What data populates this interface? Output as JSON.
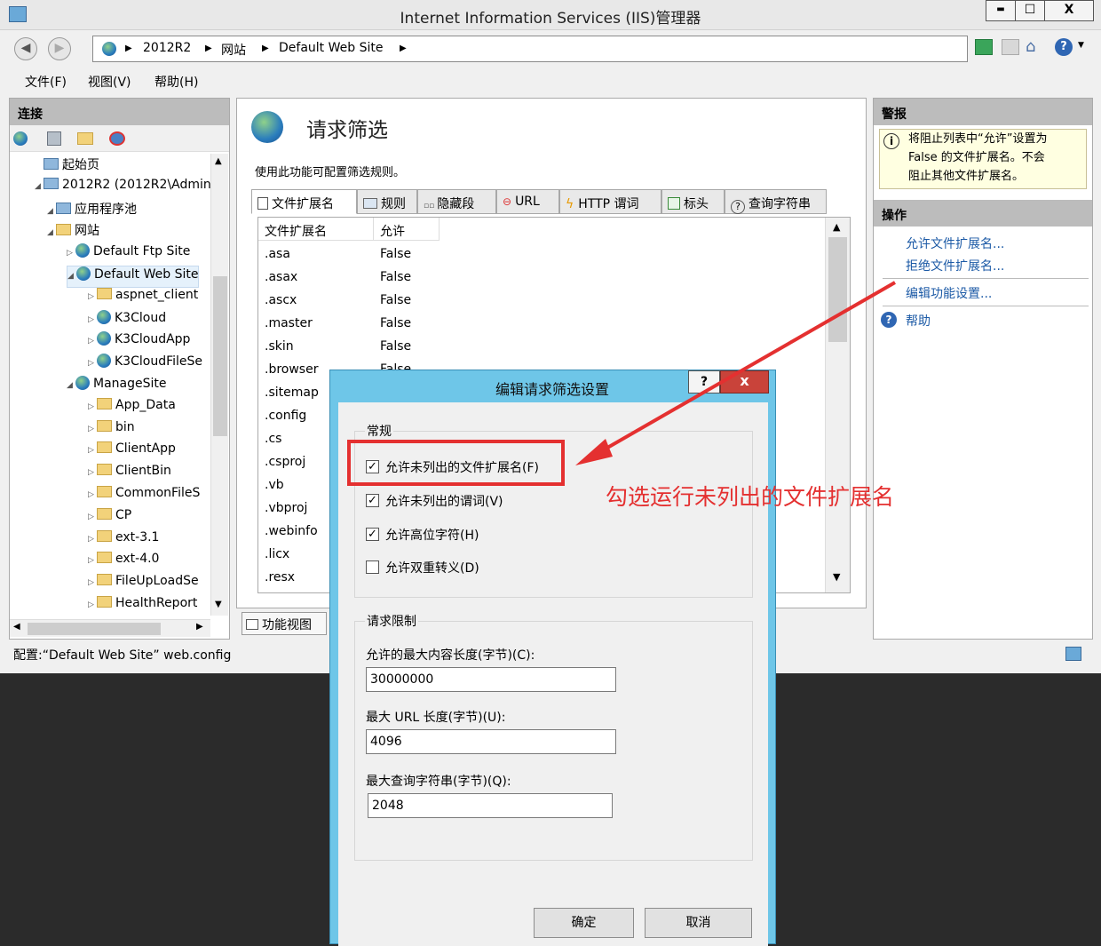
{
  "window": {
    "title": "Internet Information Services (IIS)管理器",
    "min": "▬",
    "max": "☐",
    "close": "X"
  },
  "breadcrumb": [
    "2012R2",
    "网站",
    "Default Web Site"
  ],
  "menubar": [
    "文件(F)",
    "视图(V)",
    "帮助(H)"
  ],
  "connections": {
    "header": "连接",
    "tree": [
      {
        "label": "起始页",
        "indent": 0,
        "icon": "home"
      },
      {
        "label": "2012R2 (2012R2\\Admini",
        "indent": 0,
        "icon": "server"
      },
      {
        "label": "应用程序池",
        "indent": 1,
        "icon": "pool"
      },
      {
        "label": "网站",
        "indent": 1,
        "icon": "sites"
      },
      {
        "label": "Default Ftp Site",
        "indent": 2,
        "icon": "globe"
      },
      {
        "label": "Default Web Site",
        "indent": 2,
        "icon": "globe"
      },
      {
        "label": "aspnet_client",
        "indent": 3,
        "icon": "folder"
      },
      {
        "label": "K3Cloud",
        "indent": 3,
        "icon": "app"
      },
      {
        "label": "K3CloudApp",
        "indent": 3,
        "icon": "app"
      },
      {
        "label": "K3CloudFileSe",
        "indent": 3,
        "icon": "app"
      },
      {
        "label": "ManageSite",
        "indent": 2,
        "icon": "globe"
      },
      {
        "label": "App_Data",
        "indent": 3,
        "icon": "folder"
      },
      {
        "label": "bin",
        "indent": 3,
        "icon": "folder"
      },
      {
        "label": "ClientApp",
        "indent": 3,
        "icon": "folder"
      },
      {
        "label": "ClientBin",
        "indent": 3,
        "icon": "folder"
      },
      {
        "label": "CommonFileS",
        "indent": 3,
        "icon": "folder"
      },
      {
        "label": "CP",
        "indent": 3,
        "icon": "folder"
      },
      {
        "label": "ext-3.1",
        "indent": 3,
        "icon": "folder"
      },
      {
        "label": "ext-4.0",
        "indent": 3,
        "icon": "folder"
      },
      {
        "label": "FileUpLoadSe",
        "indent": 3,
        "icon": "folder"
      },
      {
        "label": "HealthReport",
        "indent": 3,
        "icon": "folder"
      }
    ]
  },
  "main": {
    "title": "请求筛选",
    "description": "使用此功能可配置筛选规则。",
    "tabs": [
      "文件扩展名",
      "规则",
      "隐藏段",
      "URL",
      "HTTP 谓词",
      "标头",
      "查询字符串"
    ],
    "columns": [
      "文件扩展名",
      "允许"
    ],
    "rows": [
      [
        ".asa",
        "False"
      ],
      [
        ".asax",
        "False"
      ],
      [
        ".ascx",
        "False"
      ],
      [
        ".master",
        "False"
      ],
      [
        ".skin",
        "False"
      ],
      [
        ".browser",
        "False"
      ],
      [
        ".sitemap",
        ""
      ],
      [
        ".config",
        ""
      ],
      [
        ".cs",
        ""
      ],
      [
        ".csproj",
        ""
      ],
      [
        ".vb",
        ""
      ],
      [
        ".vbproj",
        ""
      ],
      [
        ".webinfo",
        ""
      ],
      [
        ".licx",
        ""
      ],
      [
        ".resx",
        ""
      ]
    ],
    "view_tab": "功能视图"
  },
  "alerts": {
    "header": "警报",
    "line1": "将阻止列表中“允许”设置为",
    "line2": "False 的文件扩展名。不会",
    "line3": "阻止其他文件扩展名。"
  },
  "actions": {
    "header": "操作",
    "allow": "允许文件扩展名...",
    "deny": "拒绝文件扩展名...",
    "edit": "编辑功能设置...",
    "help": "帮助"
  },
  "status": {
    "config": "配置:“Default Web Site” web.config"
  },
  "dialog": {
    "title": "编辑请求筛选设置",
    "help": "?",
    "close": "x",
    "general": "常规",
    "checkboxes": [
      {
        "label": "允许未列出的文件扩展名(F)",
        "checked": true
      },
      {
        "label": "允许未列出的谓词(V)",
        "checked": true
      },
      {
        "label": "允许高位字符(H)",
        "checked": true
      },
      {
        "label": "允许双重转义(D)",
        "checked": false
      }
    ],
    "limits": "请求限制",
    "max_content_label": "允许的最大内容长度(字节)(C):",
    "max_content_value": "30000000",
    "max_url_label": "最大 URL 长度(字节)(U):",
    "max_url_value": "4096",
    "max_query_label": "最大查询字符串(字节)(Q):",
    "max_query_value": "2048",
    "ok": "确定",
    "cancel": "取消"
  },
  "annotation": "勾选运行未列出的文件扩展名"
}
